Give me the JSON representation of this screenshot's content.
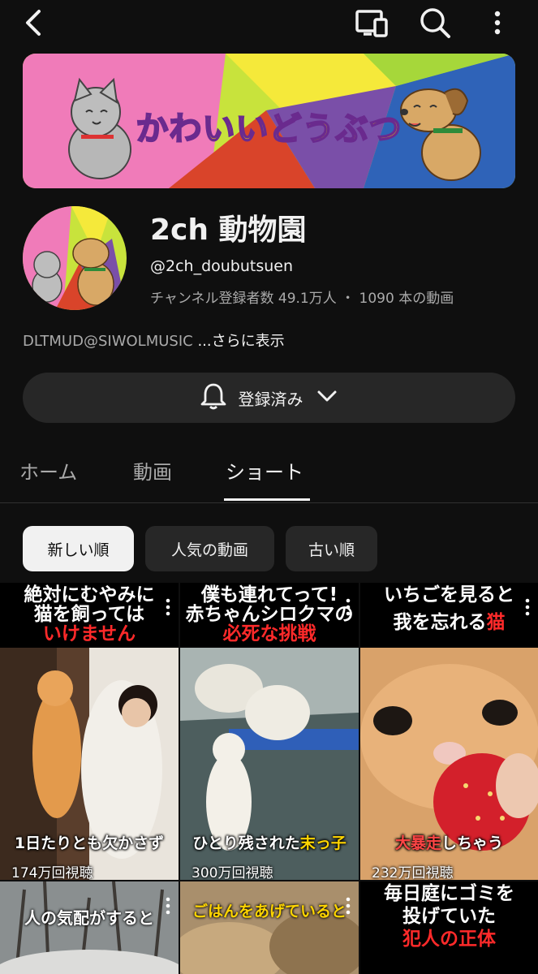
{
  "channel": {
    "name": "2ch 動物園",
    "handle": "@2ch_doubutsuen",
    "stats": "チャンネル登録者数 49.1万人 ・ 1090 本の動画",
    "description": "DLTMUD@SIWOLMUSIC",
    "more": "...さらに表示",
    "banner_text": "かわいいどうぶつ"
  },
  "subscribe_button": {
    "label": "登録済み"
  },
  "tabs": [
    {
      "label": "ホーム"
    },
    {
      "label": "動画"
    },
    {
      "label": "ショート"
    }
  ],
  "active_tab": "ショート",
  "sort_chips": [
    {
      "label": "新しい順"
    },
    {
      "label": "人気の動画"
    },
    {
      "label": "古い順"
    }
  ],
  "active_chip": "新しい順",
  "shorts": [
    {
      "line1": "絶対にむやみに",
      "line2": "猫を飼っては",
      "line3_red": "いけません",
      "subtitle": "1日たりとも欠かさず",
      "views": "174万回視聴"
    },
    {
      "line1": "僕も連れてって!",
      "line2": "赤ちゃんシロクマの",
      "line3_red": "必死な挑戦",
      "subtitle_a": "ひとり残された",
      "subtitle_b": "末っ子",
      "views": "300万回視聴"
    },
    {
      "line1": "いちごを見ると",
      "line2_a": "我を忘れる",
      "line2_b": "猫",
      "subtitle_a": "大暴走",
      "subtitle_b": "しちゃう",
      "views": "232万回視聴"
    },
    {
      "caption": "人の気配がすると"
    },
    {
      "caption": "ごはんをあげていると"
    },
    {
      "line1": "毎日庭にゴミを",
      "line2": "投げていた",
      "line3_red": "犯人の正体"
    }
  ],
  "colors": {
    "background": "#0f0f0f",
    "chip_bg": "#272727",
    "accent_red": "#ff2a2a",
    "caption_yellow": "#ffd500"
  },
  "icons": [
    "back-arrow-icon",
    "cast-icon",
    "search-icon",
    "more-vert-icon",
    "bell-icon",
    "chevron-down-icon"
  ]
}
